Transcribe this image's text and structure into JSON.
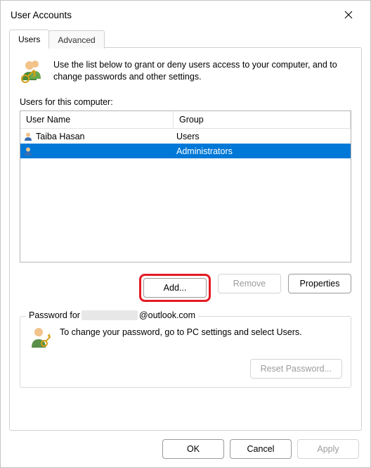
{
  "window": {
    "title": "User Accounts"
  },
  "tabs": {
    "users": "Users",
    "advanced": "Advanced"
  },
  "intro": "Use the list below to grant or deny users access to your computer, and to change passwords and other settings.",
  "list": {
    "label": "Users for this computer:",
    "col_username": "User Name",
    "col_group": "Group",
    "rows": [
      {
        "name": "Taiba Hasan",
        "group": "Users"
      },
      {
        "name": "",
        "group": "Administrators"
      }
    ]
  },
  "buttons": {
    "add": "Add...",
    "remove": "Remove",
    "properties": "Properties"
  },
  "password": {
    "legend_prefix": "Password for",
    "legend_suffix": "@outlook.com",
    "text": "To change your password, go to PC settings and select Users.",
    "reset": "Reset Password..."
  },
  "footer": {
    "ok": "OK",
    "cancel": "Cancel",
    "apply": "Apply"
  }
}
